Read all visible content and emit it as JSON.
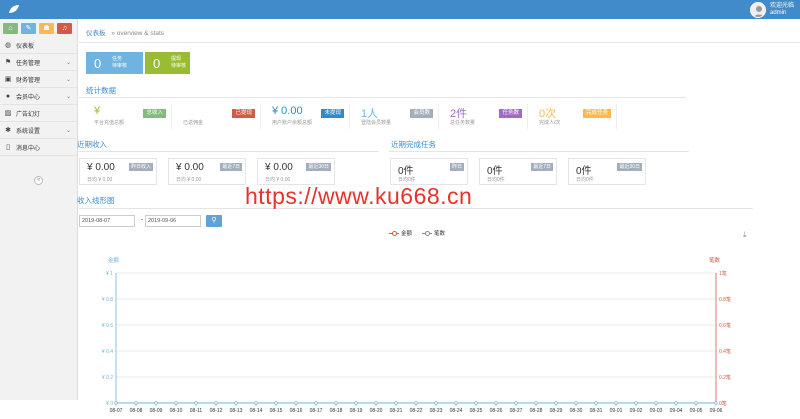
{
  "header": {
    "welcome": "欢迎光临",
    "user": "admin"
  },
  "colors": {
    "topbar": "#428bca",
    "blue": "#6fb3e0",
    "green": "#9abc32",
    "orange": "#ffb752",
    "red": "#d15b47",
    "purple": "#a069c3",
    "dark_blue": "#2e8bcc"
  },
  "sidebar": {
    "buttons": [
      {
        "icon": "home-icon",
        "glyph": "⌂",
        "color": "#87b87f"
      },
      {
        "icon": "pencil-icon",
        "glyph": "✎",
        "color": "#6fb3e0"
      },
      {
        "icon": "users-icon",
        "glyph": "☗",
        "color": "#ffb752"
      },
      {
        "icon": "bell-icon",
        "glyph": "♫",
        "color": "#d15b47"
      }
    ],
    "items": [
      {
        "label": "仪表板",
        "icon": "dashboard-icon",
        "glyph": "◍",
        "chev": ""
      },
      {
        "label": "任务管理",
        "icon": "flag-icon",
        "glyph": "⚑",
        "chev": "⌄"
      },
      {
        "label": "财务管理",
        "icon": "wallet-icon",
        "glyph": "▣",
        "chev": "⌄"
      },
      {
        "label": "会员中心",
        "icon": "user-icon",
        "glyph": "●",
        "chev": "⌄"
      },
      {
        "label": "广告幻灯",
        "icon": "picture-icon",
        "glyph": "▨",
        "chev": ""
      },
      {
        "label": "系统设置",
        "icon": "gear-icon",
        "glyph": "✱",
        "chev": "⌄"
      },
      {
        "label": "消息中心",
        "icon": "bookmark-icon",
        "glyph": "▯",
        "chev": ""
      }
    ],
    "collapse": "«"
  },
  "breadcrumb": {
    "title": "仪表板",
    "sub": "» overview & stats"
  },
  "pending": [
    {
      "num": "0",
      "line1": "任务",
      "line2": "待审核",
      "color": "#6fb3e0"
    },
    {
      "num": "0",
      "line1": "提现",
      "line2": "待审核",
      "color": "#9abc32"
    }
  ],
  "stats": {
    "title": "统计数据",
    "items": [
      {
        "value": "¥",
        "desc": "平台充值总额",
        "tag": "总收入",
        "color": "#87b87f",
        "valcolor": "#9abc32"
      },
      {
        "value": "",
        "desc": "已返佣金",
        "tag": "已提现",
        "color": "#d15b47",
        "valcolor": "#d15b47"
      },
      {
        "value": "¥ 0.00",
        "desc": "用户账户余额总额",
        "tag": "未提现",
        "color": "#2e8bcc",
        "valcolor": "#2e8bcc"
      },
      {
        "value": "1人",
        "desc": "登陆会员数量",
        "tag": "会员数",
        "color": "#a3aebc",
        "valcolor": "#6fb3e0"
      },
      {
        "value": "2件",
        "desc": "总任务数量",
        "tag": "任务数",
        "color": "#a069c3",
        "valcolor": "#a069c3"
      },
      {
        "value": "0次",
        "desc": "完成人/次",
        "tag": "完成任务",
        "color": "#ffb752",
        "valcolor": "#ffb752"
      }
    ]
  },
  "income": {
    "title": "近期收入",
    "cards": [
      {
        "value": "¥ 0.00",
        "desc": "日均 ¥ 0.00",
        "tag": "昨日收入"
      },
      {
        "value": "¥ 0.00",
        "desc": "日均 ¥ 0.00",
        "tag": "最近7日"
      },
      {
        "value": "¥ 0.00",
        "desc": "日均 ¥ 0.00",
        "tag": "最近30日"
      }
    ]
  },
  "tasks": {
    "title": "近期完成任务",
    "cards": [
      {
        "value": "0件",
        "desc": "日均0件",
        "tag": "昨日"
      },
      {
        "value": "0件",
        "desc": "日均0件",
        "tag": "最近7日"
      },
      {
        "value": "0件",
        "desc": "日均0件",
        "tag": "最近30日"
      }
    ]
  },
  "trend": {
    "title": "收入线形图",
    "start_date": "2019-08-07",
    "separator": "-",
    "end_date": "2019-09-06",
    "search_glyph": "⚲",
    "download_glyph": "⤓"
  },
  "watermark": "https://www.ku668.cn",
  "chart_data": {
    "type": "line",
    "title": "",
    "legend": [
      "金额",
      "笔数"
    ],
    "legend_position": "top-center",
    "left_axis_label": "金额",
    "right_axis_label": "笔数",
    "left_ticks": [
      "¥ 0",
      "¥ 0.2",
      "¥ 0.4",
      "¥ 0.6",
      "¥ 0.8",
      "¥ 1"
    ],
    "right_ticks": [
      "0笔",
      "0.2笔",
      "0.4笔",
      "0.6笔",
      "0.8笔",
      "1笔"
    ],
    "ylim": [
      0,
      1
    ],
    "grid": true,
    "categories": [
      "08-07",
      "08-08",
      "08-09",
      "08-10",
      "08-11",
      "08-12",
      "08-13",
      "08-14",
      "08-15",
      "08-16",
      "08-17",
      "08-18",
      "08-19",
      "08-20",
      "08-21",
      "08-22",
      "08-23",
      "08-24",
      "08-25",
      "08-26",
      "08-27",
      "08-28",
      "08-29",
      "08-30",
      "08-31",
      "09-01",
      "09-02",
      "09-03",
      "09-04",
      "09-05",
      "09-06"
    ],
    "series": [
      {
        "name": "金额",
        "color": "#d15b47",
        "values": [
          0,
          0,
          0,
          0,
          0,
          0,
          0,
          0,
          0,
          0,
          0,
          0,
          0,
          0,
          0,
          0,
          0,
          0,
          0,
          0,
          0,
          0,
          0,
          0,
          0,
          0,
          0,
          0,
          0,
          0,
          0
        ]
      },
      {
        "name": "笔数",
        "color": "#6fb3e0",
        "values": [
          0,
          0,
          0,
          0,
          0,
          0,
          0,
          0,
          0,
          0,
          0,
          0,
          0,
          0,
          0,
          0,
          0,
          0,
          0,
          0,
          0,
          0,
          0,
          0,
          0,
          0,
          0,
          0,
          0,
          0,
          0
        ]
      }
    ]
  }
}
